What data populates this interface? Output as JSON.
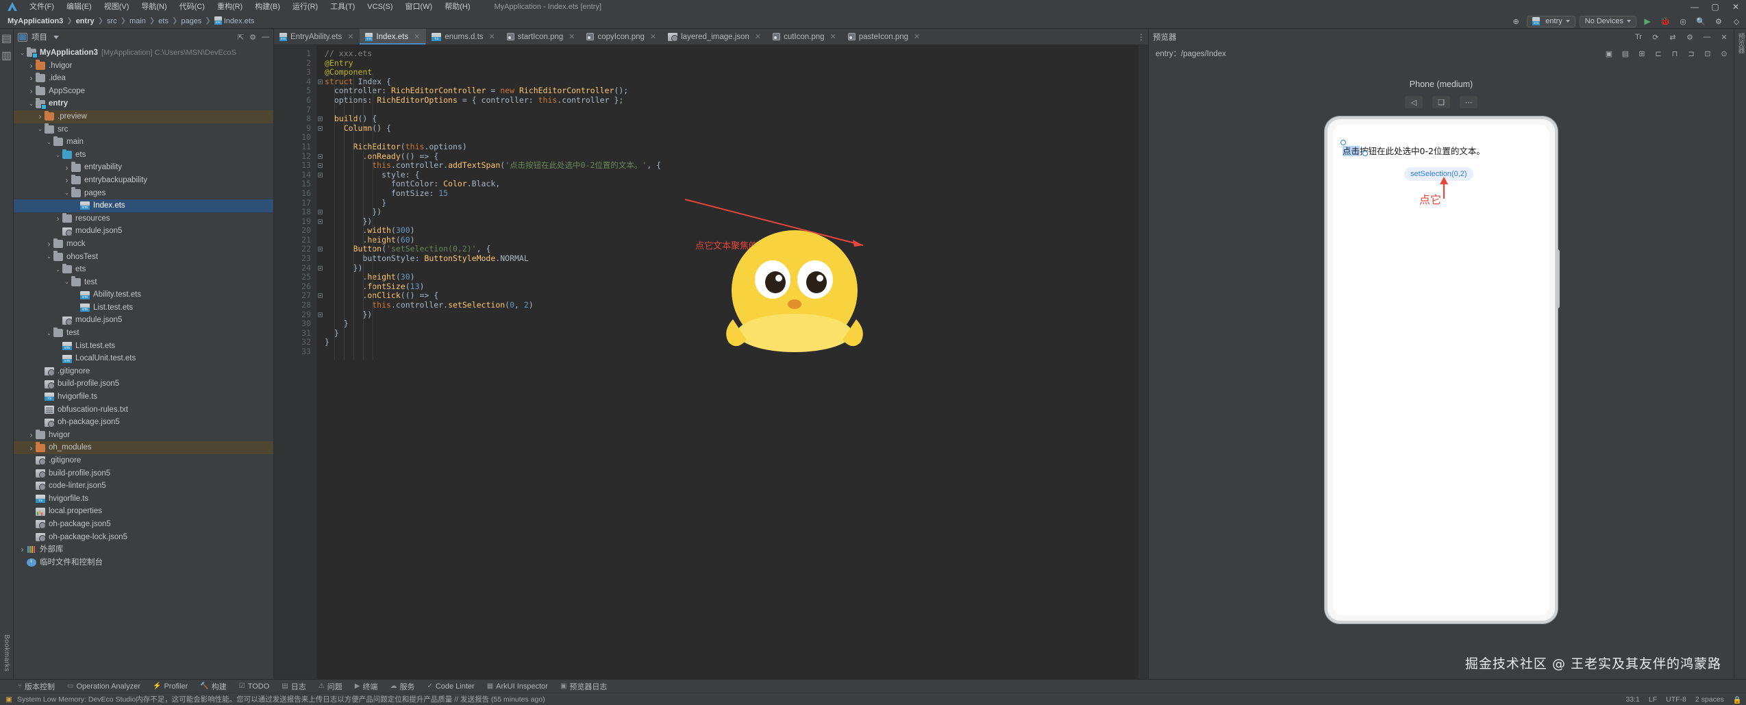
{
  "menubar": {
    "items": [
      "文件(F)",
      "编辑(E)",
      "视图(V)",
      "导航(N)",
      "代码(C)",
      "重构(R)",
      "构建(B)",
      "运行(R)",
      "工具(T)",
      "VCS(S)",
      "窗口(W)",
      "帮助(H)"
    ],
    "window_title": "MyApplication - Index.ets [entry]",
    "minimize": "—",
    "maximize": "▢",
    "close": "✕"
  },
  "toolbar": {
    "breadcrumb": [
      "MyApplication3",
      "entry",
      "src",
      "main",
      "ets",
      "pages",
      "Index.ets"
    ],
    "run_config": "entry",
    "device": "No Devices",
    "run_label": "▶",
    "debug_label": "🐞",
    "icons": [
      "search-icon",
      "settings-icon",
      "notification-icon",
      "layout-icon"
    ]
  },
  "project_panel": {
    "title": "项目",
    "tree": [
      {
        "depth": 0,
        "label": "MyApplication3",
        "sub": "[MyApplication]  C:\\Users\\MSN\\DevEcoS",
        "icon": "folder-module",
        "twisty": "v",
        "bold": true
      },
      {
        "depth": 1,
        "label": ".hvigor",
        "icon": "folder-orange",
        "twisty": ">"
      },
      {
        "depth": 1,
        "label": ".idea",
        "icon": "folder",
        "twisty": ">"
      },
      {
        "depth": 1,
        "label": "AppScope",
        "icon": "folder",
        "twisty": ">"
      },
      {
        "depth": 1,
        "label": "entry",
        "icon": "folder-module",
        "twisty": "v",
        "bold": true
      },
      {
        "depth": 2,
        "label": ".preview",
        "icon": "folder-orange",
        "twisty": ">",
        "hl": true
      },
      {
        "depth": 2,
        "label": "src",
        "icon": "folder",
        "twisty": "v"
      },
      {
        "depth": 3,
        "label": "main",
        "icon": "folder",
        "twisty": "v"
      },
      {
        "depth": 4,
        "label": "ets",
        "icon": "folder-blue",
        "twisty": "v"
      },
      {
        "depth": 5,
        "label": "entryability",
        "icon": "folder",
        "twisty": ">"
      },
      {
        "depth": 5,
        "label": "entrybackupability",
        "icon": "folder",
        "twisty": ">"
      },
      {
        "depth": 5,
        "label": "pages",
        "icon": "folder",
        "twisty": "v"
      },
      {
        "depth": 6,
        "label": "Index.ets",
        "icon": "file-ets",
        "twisty": "",
        "selected": true
      },
      {
        "depth": 4,
        "label": "resources",
        "icon": "folder",
        "twisty": ">"
      },
      {
        "depth": 4,
        "label": "module.json5",
        "icon": "file-json",
        "twisty": ""
      },
      {
        "depth": 3,
        "label": "mock",
        "icon": "folder",
        "twisty": ">"
      },
      {
        "depth": 3,
        "label": "ohosTest",
        "icon": "folder",
        "twisty": "v"
      },
      {
        "depth": 4,
        "label": "ets",
        "icon": "folder",
        "twisty": "v"
      },
      {
        "depth": 5,
        "label": "test",
        "icon": "folder",
        "twisty": "v"
      },
      {
        "depth": 6,
        "label": "Ability.test.ets",
        "icon": "file-ets",
        "twisty": ""
      },
      {
        "depth": 6,
        "label": "List.test.ets",
        "icon": "file-ets",
        "twisty": ""
      },
      {
        "depth": 4,
        "label": "module.json5",
        "icon": "file-json",
        "twisty": ""
      },
      {
        "depth": 3,
        "label": "test",
        "icon": "folder",
        "twisty": "v"
      },
      {
        "depth": 4,
        "label": "List.test.ets",
        "icon": "file-ets",
        "twisty": ""
      },
      {
        "depth": 4,
        "label": "LocalUnit.test.ets",
        "icon": "file-ets",
        "twisty": ""
      },
      {
        "depth": 2,
        "label": ".gitignore",
        "icon": "file-json",
        "twisty": ""
      },
      {
        "depth": 2,
        "label": "build-profile.json5",
        "icon": "file-json",
        "twisty": ""
      },
      {
        "depth": 2,
        "label": "hvigorfile.ts",
        "icon": "file-ts",
        "twisty": ""
      },
      {
        "depth": 2,
        "label": "obfuscation-rules.txt",
        "icon": "file-txt",
        "twisty": ""
      },
      {
        "depth": 2,
        "label": "oh-package.json5",
        "icon": "file-json",
        "twisty": ""
      },
      {
        "depth": 1,
        "label": "hvigor",
        "icon": "folder",
        "twisty": ">"
      },
      {
        "depth": 1,
        "label": "oh_modules",
        "icon": "folder-orange",
        "twisty": ">",
        "hl": true
      },
      {
        "depth": 1,
        "label": ".gitignore",
        "icon": "file-json",
        "twisty": ""
      },
      {
        "depth": 1,
        "label": "build-profile.json5",
        "icon": "file-json",
        "twisty": ""
      },
      {
        "depth": 1,
        "label": "code-linter.json5",
        "icon": "file-json",
        "twisty": ""
      },
      {
        "depth": 1,
        "label": "hvigorfile.ts",
        "icon": "file-ts",
        "twisty": ""
      },
      {
        "depth": 1,
        "label": "local.properties",
        "icon": "file-prop",
        "twisty": ""
      },
      {
        "depth": 1,
        "label": "oh-package.json5",
        "icon": "file-json",
        "twisty": ""
      },
      {
        "depth": 1,
        "label": "oh-package-lock.json5",
        "icon": "file-json",
        "twisty": ""
      },
      {
        "depth": 0,
        "label": "外部库",
        "icon": "library",
        "twisty": ">"
      },
      {
        "depth": 0,
        "label": "临时文件和控制台",
        "icon": "clock",
        "twisty": ""
      }
    ]
  },
  "left_rail": {
    "labels": [
      "项目",
      "结构"
    ]
  },
  "right_rail": {
    "labels": [
      "预览器",
      "Previewer"
    ]
  },
  "editor": {
    "tabs": [
      {
        "label": "EntryAbility.ets",
        "icon": "ets-icon",
        "active": false
      },
      {
        "label": "Index.ets",
        "icon": "ets-icon",
        "active": true
      },
      {
        "label": "enums.d.ts",
        "icon": "ts-icon",
        "active": false
      },
      {
        "label": "startIcon.png",
        "icon": "image-icon",
        "active": false
      },
      {
        "label": "copyIcon.png",
        "icon": "image-icon",
        "active": false
      },
      {
        "label": "layered_image.json",
        "icon": "json-icon",
        "active": false
      },
      {
        "label": "cutIcon.png",
        "icon": "image-icon",
        "active": false
      },
      {
        "label": "pasteIcon.png",
        "icon": "image-icon",
        "active": false
      }
    ],
    "lines": [
      {
        "n": 1,
        "html": "<span class='cmt'>// xxx.ets</span>"
      },
      {
        "n": 2,
        "html": "<span class='dec'>@Entry</span>"
      },
      {
        "n": 3,
        "html": "<span class='dec'>@Component</span>"
      },
      {
        "n": 4,
        "html": "<span class='kw'>struct</span> <span class='pl'>Index</span> {",
        "fold": true
      },
      {
        "n": 5,
        "html": "  <span class='pl'>controller</span>: <span class='typ'>RichEditorController</span> = <span class='kw'>new</span> <span class='typ'>RichEditorController</span>();"
      },
      {
        "n": 6,
        "html": "  <span class='pl'>options</span>: <span class='typ'>RichEditorOptions</span> = { <span class='pl'>controller</span>: <span class='kw'>this</span>.<span class='pl'>controller</span> };"
      },
      {
        "n": 7,
        "html": ""
      },
      {
        "n": 8,
        "html": "  <span class='fn'>build</span>() {",
        "fold": true
      },
      {
        "n": 9,
        "html": "    <span class='typ'>Column</span>() {",
        "fold": true
      },
      {
        "n": 10,
        "html": ""
      },
      {
        "n": 11,
        "html": "      <span class='typ'>RichEditor</span>(<span class='kw'>this</span>.<span class='pl'>options</span>)"
      },
      {
        "n": 12,
        "html": "        .<span class='fn'>onReady</span>(() =&gt; {",
        "fold": true
      },
      {
        "n": 13,
        "html": "          <span class='kw'>this</span>.<span class='pl'>controller</span>.<span class='fn'>addTextSpan</span>(<span class='str'>'点击按钮在此处选中0-2位置的文本。'</span>, {",
        "fold": true
      },
      {
        "n": 14,
        "html": "            <span class='pl'>style</span>: {",
        "fold": true
      },
      {
        "n": 15,
        "html": "              <span class='pl'>fontColor</span>: <span class='typ'>Color</span>.<span class='pl'>Black</span>,"
      },
      {
        "n": 16,
        "html": "              <span class='pl'>fontSize</span>: <span class='num'>15</span>"
      },
      {
        "n": 17,
        "html": "            }"
      },
      {
        "n": 18,
        "html": "          })",
        "fold": true
      },
      {
        "n": 19,
        "html": "        })",
        "fold": true
      },
      {
        "n": 20,
        "html": "        .<span class='fn'>width</span>(<span class='num'>300</span>)"
      },
      {
        "n": 21,
        "html": "        .<span class='fn'>height</span>(<span class='num'>60</span>)"
      },
      {
        "n": 22,
        "html": "      <span class='typ'>Button</span>(<span class='str'>'setSelection(0,2)'</span>, {",
        "fold": true
      },
      {
        "n": 23,
        "html": "        <span class='pl'>buttonStyle</span>: <span class='typ'>ButtonStyleMode</span>.<span class='pl'>NORMAL</span>"
      },
      {
        "n": 24,
        "html": "      })",
        "fold": true
      },
      {
        "n": 25,
        "html": "        .<span class='fn'>height</span>(<span class='num'>30</span>)"
      },
      {
        "n": 26,
        "html": "        .<span class='fn'>fontSize</span>(<span class='num'>13</span>)"
      },
      {
        "n": 27,
        "html": "        .<span class='fn'>onClick</span>(() =&gt; {",
        "fold": true
      },
      {
        "n": 28,
        "html": "          <span class='kw'>this</span>.<span class='pl'>controller</span>.<span class='fn'>setSelection</span>(<span class='num'>0</span>, <span class='num'>2</span>)"
      },
      {
        "n": 29,
        "html": "        })",
        "fold": true
      },
      {
        "n": 30,
        "html": "    }"
      },
      {
        "n": 31,
        "html": "  }"
      },
      {
        "n": 32,
        "html": "}"
      },
      {
        "n": 33,
        "html": ""
      }
    ],
    "annotation": "点它文本聚焦的内容即可呈现"
  },
  "preview": {
    "title": "预览器",
    "breadcrumb": "entry：/pages/Index",
    "device_name": "Phone (medium)",
    "device_buttons": [
      "rotate-left-icon",
      "multi-device-icon",
      "more-icon"
    ],
    "rich_text_selected": "点击",
    "rich_text_rest": "按钮在此处选中0-2位置的文本。",
    "select_button": "setSelection(0,2)",
    "annotation": "点它",
    "header_icons": [
      "refresh-icon",
      "sync-icon",
      "settings-icon",
      "minimize-icon"
    ],
    "toolbar_icons": [
      "inspector-icon",
      "profiler-icon",
      "grid-icon",
      "align-left-icon",
      "align-center-icon",
      "align-right-icon",
      "fit-icon",
      "zoom-icon"
    ]
  },
  "watermark": "掘金技术社区 @ 王老实及其友伴的鸿蒙路",
  "bottom_tools": [
    {
      "icon": "version-control-icon",
      "label": "版本控制"
    },
    {
      "icon": "analyzer-icon",
      "label": "Operation Analyzer"
    },
    {
      "icon": "profiler-icon",
      "label": "Profiler"
    },
    {
      "icon": "build-icon",
      "label": "构建"
    },
    {
      "icon": "todo-icon",
      "label": "TODO"
    },
    {
      "icon": "log-icon",
      "label": "日志"
    },
    {
      "icon": "problems-icon",
      "label": "问题"
    },
    {
      "icon": "terminal-icon",
      "label": "终端"
    },
    {
      "icon": "services-icon",
      "label": "服务"
    },
    {
      "icon": "codelinter-icon",
      "label": "Code Linter"
    },
    {
      "icon": "arkui-icon",
      "label": "ArkUI Inspector"
    },
    {
      "icon": "previewer-icon",
      "label": "预览器日志"
    }
  ],
  "statusbar": {
    "message": "System Low Memory: DevEco Studio内存不足，这可能会影响性能。您可以通过发送报告来上传日志以方便产品问题定位和提升产品质量 // 发送报告 (55 minutes ago)",
    "caret": "33:1",
    "line_sep": "LF",
    "encoding": "UTF-8",
    "indent": "2 spaces",
    "lock": "lock-icon"
  }
}
